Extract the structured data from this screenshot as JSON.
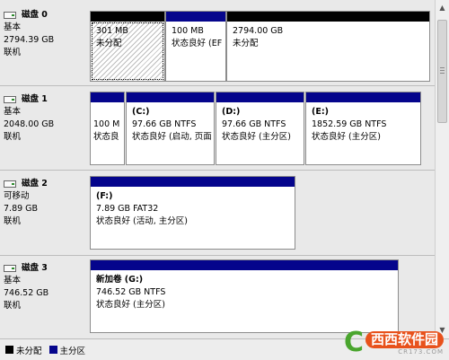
{
  "disks": [
    {
      "title": "磁盘 0",
      "type": "基本",
      "size": "2794.39 GB",
      "status": "联机",
      "partitions": [
        {
          "size": "301 MB",
          "status": "未分配"
        },
        {
          "size": "100 MB",
          "status": "状态良好 (EF"
        },
        {
          "size": "2794.00 GB",
          "status": "未分配"
        }
      ]
    },
    {
      "title": "磁盘 1",
      "type": "基本",
      "size": "2048.00 GB",
      "status": "联机",
      "partitions": [
        {
          "size": "100 M",
          "status": "状态良"
        },
        {
          "drive": "(C:)",
          "size": "97.66 GB NTFS",
          "status": "状态良好 (启动, 页面"
        },
        {
          "drive": "(D:)",
          "size": "97.66 GB NTFS",
          "status": "状态良好 (主分区)"
        },
        {
          "drive": "(E:)",
          "size": "1852.59 GB NTFS",
          "status": "状态良好 (主分区)"
        }
      ]
    },
    {
      "title": "磁盘 2",
      "type": "可移动",
      "size": "7.89 GB",
      "status": "联机",
      "partitions": [
        {
          "drive": "(F:)",
          "size": "7.89 GB FAT32",
          "status": "状态良好 (活动, 主分区)"
        }
      ]
    },
    {
      "title": "磁盘 3",
      "type": "基本",
      "size": "746.52 GB",
      "status": "联机",
      "partitions": [
        {
          "drive": "新加卷 (G:)",
          "size": "746.52 GB NTFS",
          "status": "状态良好 (主分区)"
        }
      ]
    }
  ],
  "legend": {
    "unallocated": "未分配",
    "primary": "主分区"
  },
  "colors": {
    "unallocated": "#000000",
    "primary": "#05058c"
  },
  "watermark": {
    "mark": "C",
    "name": "西西软件园",
    "url": "CR173.COM"
  }
}
